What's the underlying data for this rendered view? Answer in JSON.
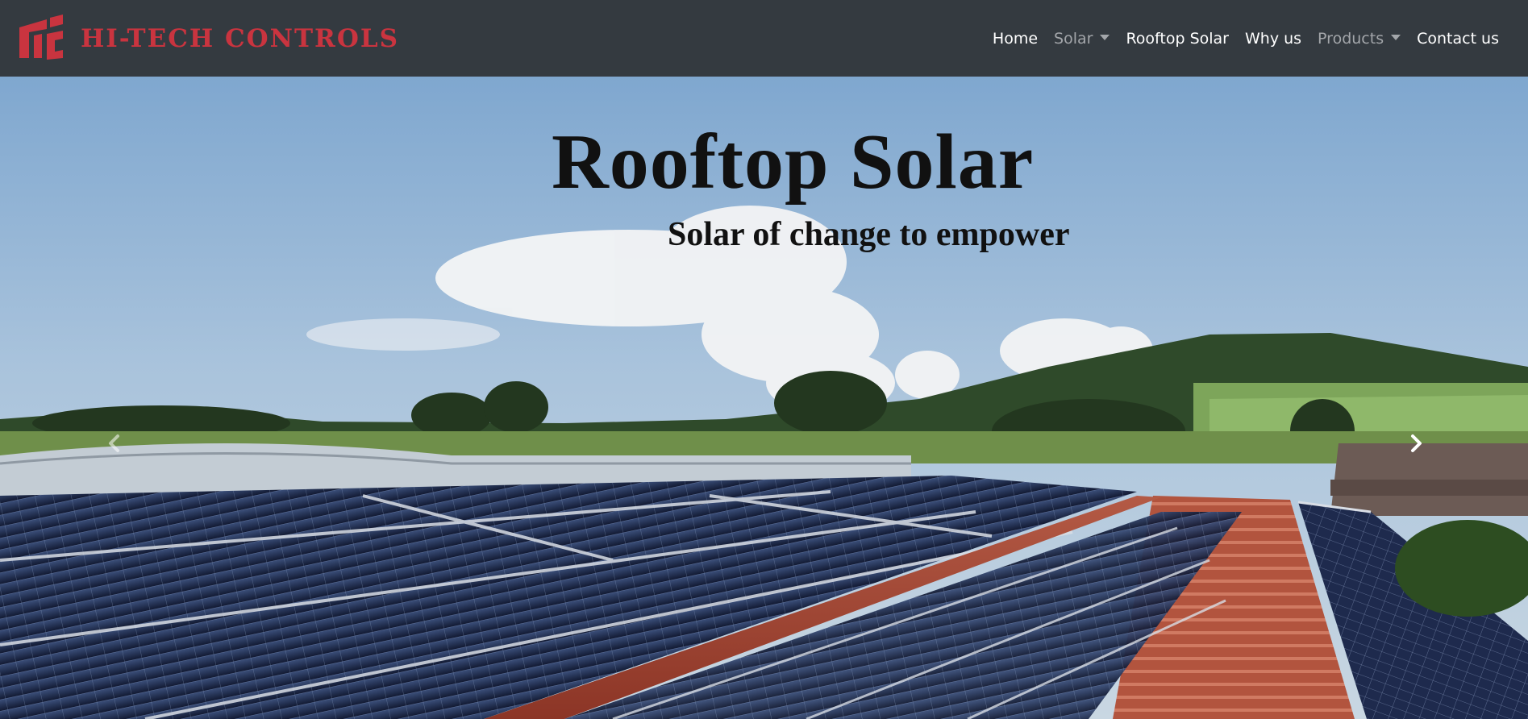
{
  "brand": {
    "name": "HI-TECH CONTROLS",
    "color": "#c9343f"
  },
  "navbar": {
    "background": "#343a40",
    "items": [
      {
        "label": "Home",
        "dropdown": false,
        "muted": false
      },
      {
        "label": "Solar",
        "dropdown": true,
        "muted": true
      },
      {
        "label": "Rooftop Solar",
        "dropdown": false,
        "muted": false
      },
      {
        "label": "Why us",
        "dropdown": false,
        "muted": false
      },
      {
        "label": "Products",
        "dropdown": true,
        "muted": true
      },
      {
        "label": "Contact us",
        "dropdown": false,
        "muted": false
      }
    ]
  },
  "hero": {
    "title": "Rooftop Solar",
    "subtitle": "Solar of change to empower",
    "prev_icon": "chevron-left-icon",
    "next_icon": "chevron-right-icon"
  }
}
